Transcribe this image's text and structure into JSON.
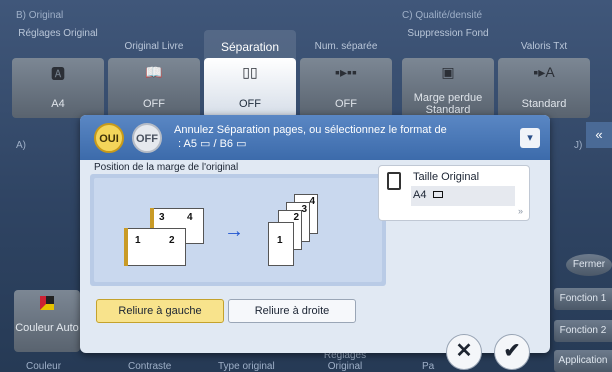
{
  "background": {
    "group_b_title": "B) Original",
    "group_c_title": "C) Qualité/densité",
    "columns": [
      {
        "label": "Réglages Original",
        "value": "A4",
        "icon": "document-a-icon"
      },
      {
        "label": "Original Livre",
        "value": "OFF",
        "icon": "book-icon"
      },
      {
        "label": "Séparation",
        "value": "OFF",
        "icon": "split-pages-icon"
      },
      {
        "label": "Num. séparée",
        "value": "OFF",
        "icon": "separate-number-icon"
      },
      {
        "label": "Suppression Fond",
        "value": "Marge perdue Standard",
        "icon": "background-removal-icon"
      },
      {
        "label": "Valoris Txt",
        "value": "Standard",
        "icon": "text-enhance-icon"
      }
    ],
    "group_a_title": "A)",
    "group_j_title": "J)",
    "color_button": "Couleur Auto",
    "bottom_tabs": [
      "Couleur",
      "Contraste",
      "Type original",
      "Réglages Original",
      "Pa"
    ],
    "side_buttons": {
      "close": "Fermer",
      "fonction1": "Fonction 1",
      "fonction2": "Fonction 2",
      "application": "Application"
    }
  },
  "dialog": {
    "toggle_on": "OUI",
    "toggle_off": "OFF",
    "message_line1": "Annulez Séparation pages, ou sélectionnez le format de",
    "message_line2": ": A5 ▭ / B6 ▭",
    "margin_title": "Position de la marge de l'original",
    "btn_left": "Reliure à gauche",
    "btn_right": "Reliure à droite",
    "original_size_label": "Taille Original",
    "original_size_value": "A4",
    "pages_before": [
      "1",
      "2",
      "3",
      "4"
    ],
    "pages_after": [
      "1",
      "2",
      "3",
      "4"
    ],
    "arrow": "→",
    "cancel": "✕",
    "ok": "✔",
    "fwd": "»"
  }
}
